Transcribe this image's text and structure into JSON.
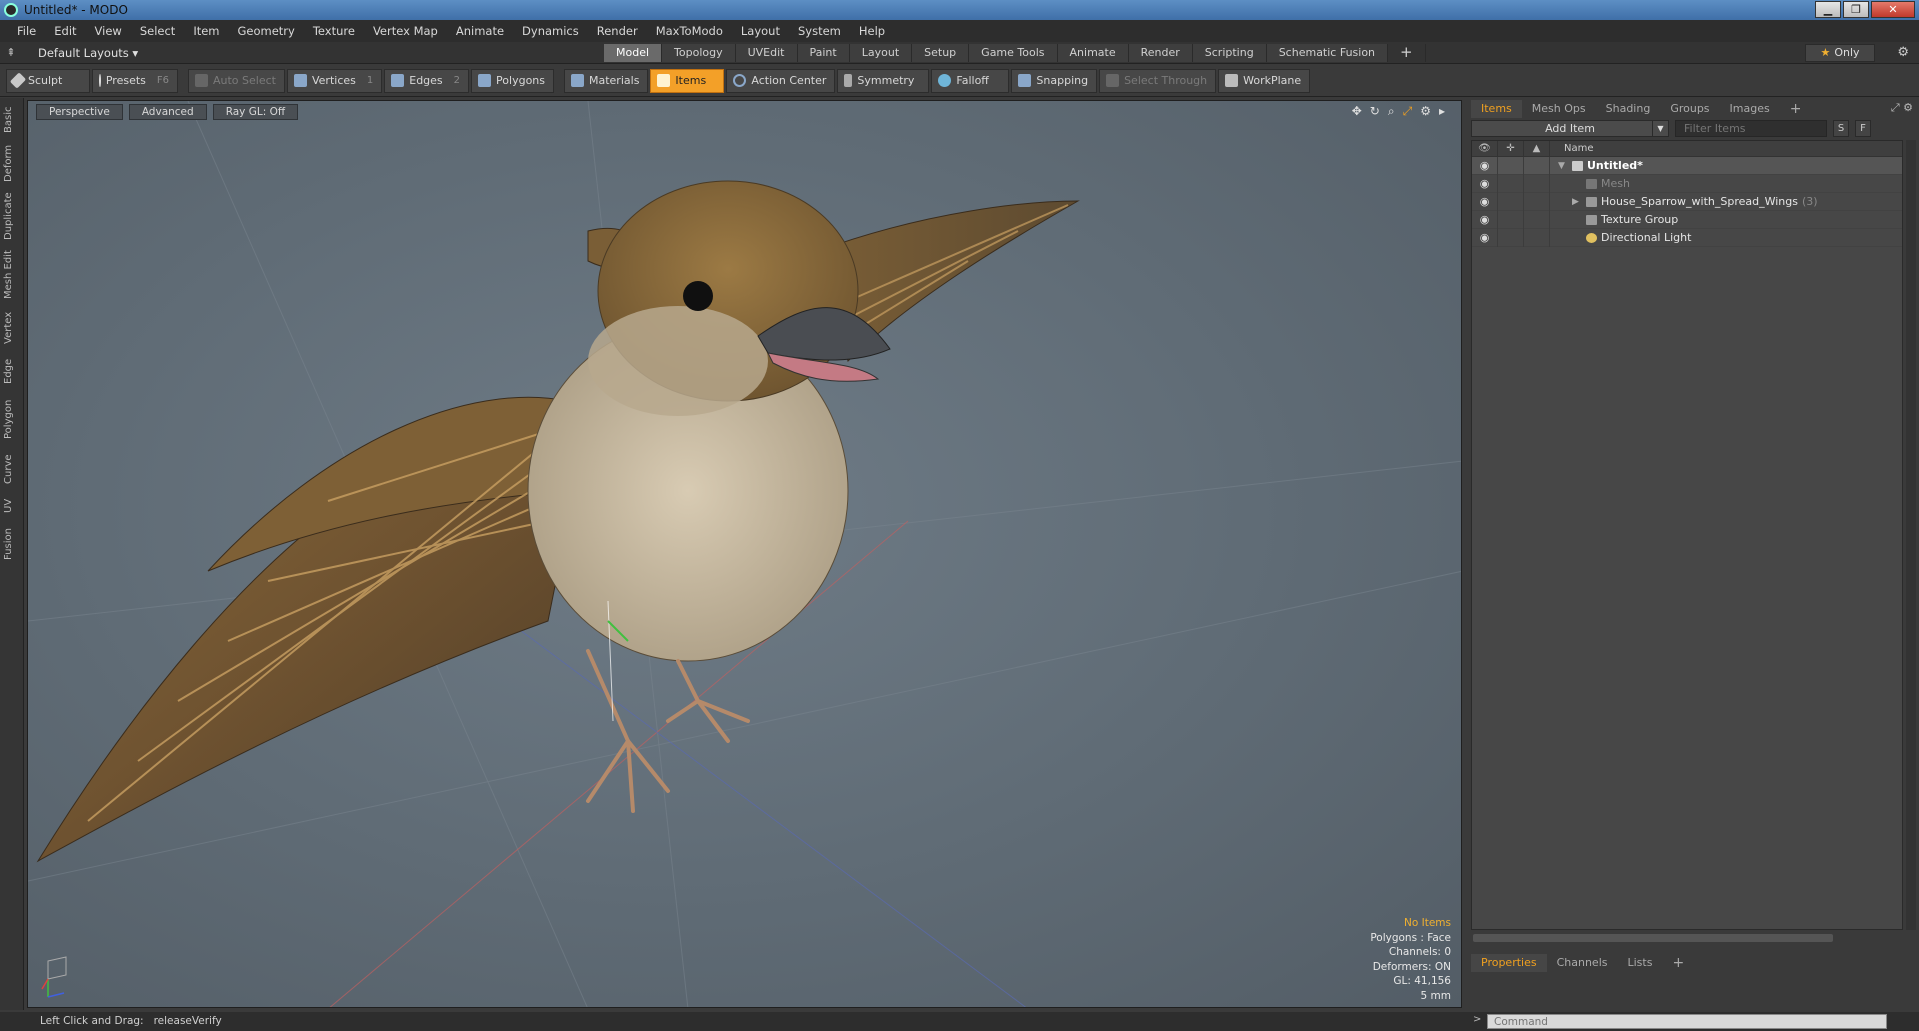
{
  "window": {
    "title": "Untitled* - MODO"
  },
  "menu": [
    "File",
    "Edit",
    "View",
    "Select",
    "Item",
    "Geometry",
    "Texture",
    "Vertex Map",
    "Animate",
    "Dynamics",
    "Render",
    "MaxToModo",
    "Layout",
    "System",
    "Help"
  ],
  "layout": {
    "selector": "Default Layouts",
    "tabs": [
      "Model",
      "Topology",
      "UVEdit",
      "Paint",
      "Layout",
      "Setup",
      "Game Tools",
      "Animate",
      "Render",
      "Scripting",
      "Schematic Fusion"
    ],
    "active_tab": "Model",
    "only_label": "Only"
  },
  "toolbar": {
    "sculpt": "Sculpt",
    "presets": "Presets",
    "presets_key": "F6",
    "auto_select": "Auto Select",
    "vertices": "Vertices",
    "vertices_key": "1",
    "edges": "Edges",
    "edges_key": "2",
    "polygons": "Polygons",
    "materials": "Materials",
    "items": "Items",
    "action_center": "Action Center",
    "symmetry": "Symmetry",
    "falloff": "Falloff",
    "snapping": "Snapping",
    "select_through": "Select Through",
    "workplane": "WorkPlane"
  },
  "left_tabs": [
    "Basic",
    "Deform",
    "Duplicate",
    "Mesh Edit",
    "Vertex",
    "Edge",
    "Polygon",
    "Curve",
    "UV",
    "Fusion"
  ],
  "viewport": {
    "view": "Perspective",
    "mode": "Advanced",
    "raygl": "Ray GL: Off",
    "hud": {
      "line1": "No Items",
      "line2": "Polygons : Face",
      "line3": "Channels: 0",
      "line4": "Deformers: ON",
      "line5": "GL: 41,156",
      "line6": "5 mm"
    }
  },
  "items_panel": {
    "tabs": [
      "Items",
      "Mesh Ops",
      "Shading",
      "Groups",
      "Images"
    ],
    "active_tab": "Items",
    "add_item": "Add Item",
    "filter_placeholder": "Filter Items",
    "s_label": "S",
    "f_label": "F",
    "name_header": "Name",
    "rows": [
      {
        "label": "Untitled*",
        "count": ""
      },
      {
        "label": "Mesh",
        "count": ""
      },
      {
        "label": "House_Sparrow_with_Spread_Wings",
        "count": "(3)"
      },
      {
        "label": "Texture Group",
        "count": ""
      },
      {
        "label": "Directional Light",
        "count": ""
      }
    ]
  },
  "properties_panel": {
    "tabs": [
      "Properties",
      "Channels",
      "Lists"
    ],
    "active_tab": "Properties"
  },
  "command": {
    "placeholder": "Command"
  },
  "status": {
    "label": "Left Click and Drag:",
    "value": "releaseVerify"
  },
  "colors": {
    "accent": "#f3a028",
    "viewport_bg": "#65717b",
    "title_bar": "#4a7fb8"
  }
}
